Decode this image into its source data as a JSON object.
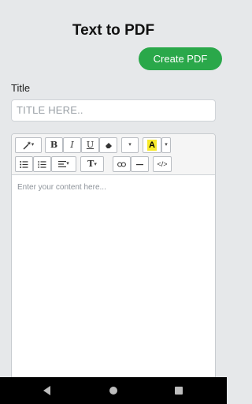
{
  "app": {
    "title": "Text to PDF"
  },
  "actions": {
    "create_pdf_label": "Create PDF"
  },
  "form": {
    "title_label": "Title",
    "title_placeholder": "TITLE HERE..",
    "content_placeholder": "Enter your content here..."
  },
  "toolbar": {
    "style_icon": "magic-wand-icon",
    "bold_label": "B",
    "italic_label": "I",
    "underline_label": "U",
    "clear_format_icon": "eraser-icon",
    "font_menu_caret": "▾",
    "color_label": "A",
    "unordered_list_icon": "bulleted-list-icon",
    "ordered_list_icon": "numbered-list-icon",
    "paragraph_icon": "align-left-icon",
    "text_size_label": "T",
    "link_icon": "link-icon",
    "hr_icon": "horizontal-rule-icon",
    "code_label": "</>"
  },
  "colors": {
    "accent": "#2aa84a",
    "highlight": "#f8ea2a",
    "background": "#e6e8ea"
  },
  "navbar": {
    "back_icon": "back-triangle-icon",
    "home_icon": "home-circle-icon",
    "recents_icon": "recents-square-icon"
  }
}
